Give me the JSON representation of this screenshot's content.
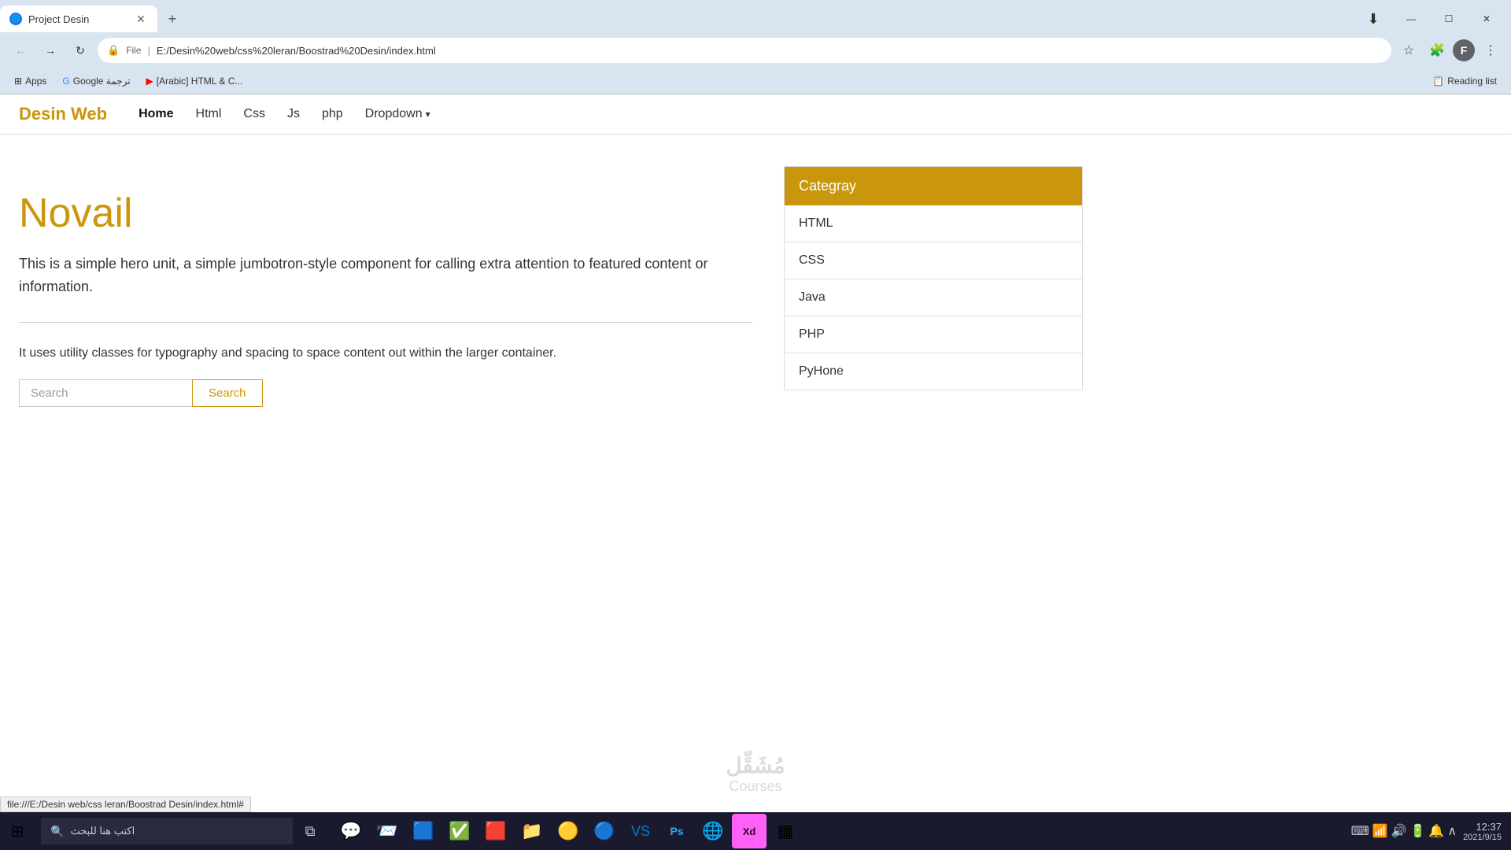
{
  "browser": {
    "tab": {
      "title": "Project Desin",
      "favicon": "🌐"
    },
    "new_tab_label": "+",
    "window_controls": {
      "minimize": "—",
      "maximize": "☐",
      "close": "✕"
    },
    "nav": {
      "back": "←",
      "forward": "→",
      "reload": "↻"
    },
    "address_bar": {
      "icon": "🔒",
      "type_label": "File",
      "url": "E:/Desin%20web/css%20leran/Boostrad%20Desin/index.html"
    },
    "toolbar_icons": {
      "star": "☆",
      "extensions": "🧩",
      "profile": "F",
      "menu": "⋮",
      "cast": "⬇"
    },
    "bookmarks": [
      {
        "icon": "⊞",
        "label": "Apps"
      },
      {
        "icon": "🔵",
        "label": "Google ترجمة"
      },
      {
        "icon": "▶",
        "label": "[Arabic] HTML & C..."
      }
    ],
    "reading_list": "Reading list"
  },
  "navbar": {
    "brand": "Desin Web",
    "links": [
      {
        "label": "Home",
        "active": true
      },
      {
        "label": "Html",
        "active": false
      },
      {
        "label": "Css",
        "active": false
      },
      {
        "label": "Js",
        "active": false
      },
      {
        "label": "php",
        "active": false
      }
    ],
    "dropdown": {
      "label": "Dropdown"
    }
  },
  "jumbotron": {
    "title": "Novail",
    "description": "This is a simple hero unit, a simple jumbotron-style component for calling extra attention to featured content or information.",
    "sub_text": "It uses utility classes for typography and spacing to space content out within the larger container.",
    "search_placeholder": "Search",
    "search_btn": "Search"
  },
  "sidebar": {
    "header": "Categray",
    "items": [
      {
        "label": "HTML"
      },
      {
        "label": "CSS"
      },
      {
        "label": "Java"
      },
      {
        "label": "PHP"
      },
      {
        "label": "PyHone"
      }
    ]
  },
  "taskbar": {
    "search_placeholder": "اكتب هنا للبحث",
    "time": "12:37",
    "date": "2021/9/15",
    "apps": [
      {
        "icon": "💬",
        "name": "chat"
      },
      {
        "icon": "📨",
        "name": "mail"
      },
      {
        "icon": "🟦",
        "name": "app1"
      },
      {
        "icon": "✅",
        "name": "tasks"
      },
      {
        "icon": "🟥",
        "name": "app2"
      },
      {
        "icon": "📁",
        "name": "files"
      },
      {
        "icon": "🟡",
        "name": "app3"
      },
      {
        "icon": "🔵",
        "name": "chrome"
      },
      {
        "icon": "🟣",
        "name": "app4"
      },
      {
        "icon": "🟤",
        "name": "adobe-xd"
      },
      {
        "icon": "▦",
        "name": "app5"
      }
    ],
    "tray_icons": [
      "🔔",
      "🔊",
      "📶",
      "🔋",
      "⌨"
    ],
    "windows_icon": "⊞"
  },
  "status_bar": {
    "url": "file:///E:/Desin web/css leran/Boostrad Desin/index.html#"
  },
  "watermark": {
    "logo": "مُشَقِّل",
    "text": "Courses"
  },
  "colors": {
    "brand_gold": "#c9960c",
    "taskbar_bg": "#1a1a2e",
    "browser_bg": "#d8e4f0"
  }
}
